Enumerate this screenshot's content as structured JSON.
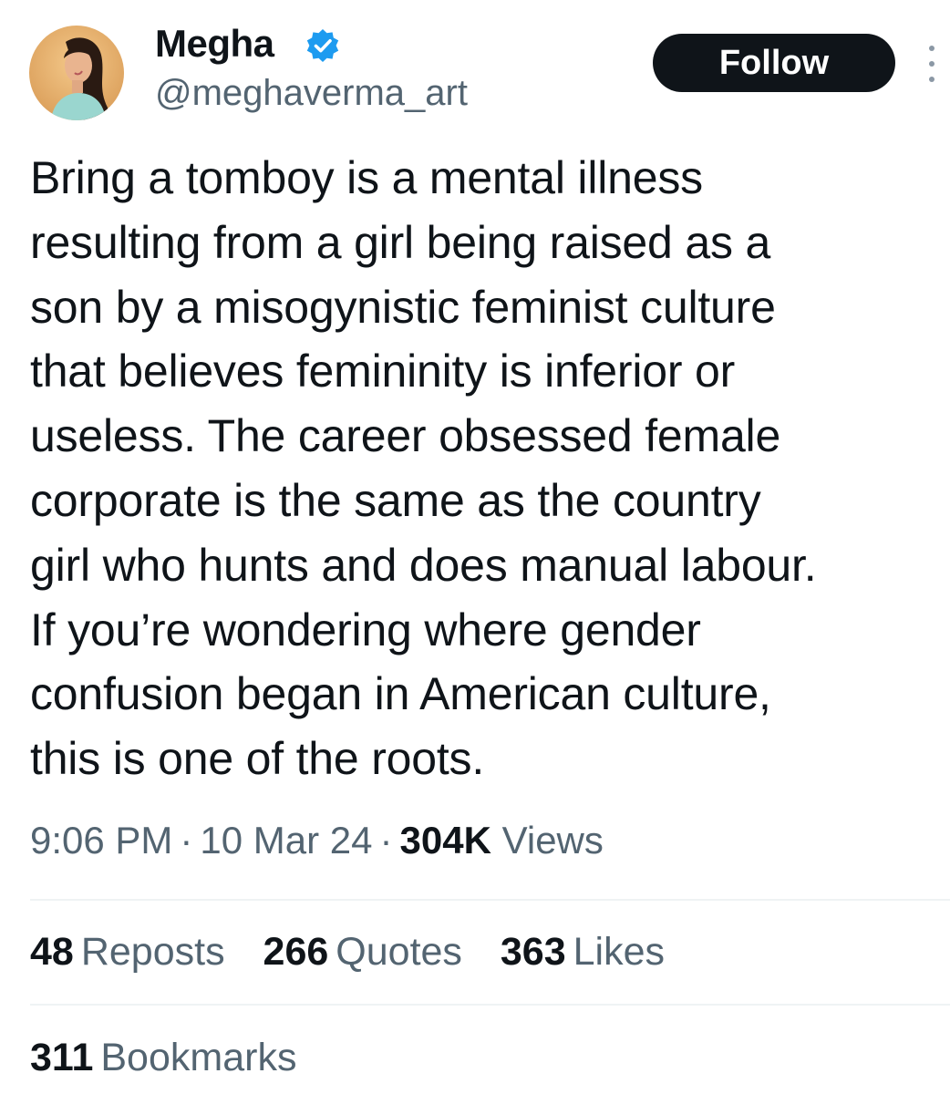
{
  "author": {
    "display_name": "Megha",
    "handle": "@meghaverma_art",
    "verified": true,
    "avatar_icon": "profile-photo"
  },
  "actions": {
    "follow_label": "Follow",
    "more_icon": "more-vertical-icon"
  },
  "tweet": {
    "text": "Bring a tomboy is a mental illness\nresulting from a girl being raised as a\nson by a misogynistic feminist culture\nthat believes femininity is inferior or\nuseless. The career obsessed female\ncorporate is the same as the country\ngirl who hunts and does manual labour.\nIf you’re wondering where gender\nconfusion began in American culture,\nthis is one of the roots.",
    "time": "9:06 PM",
    "separator": "·",
    "date": "10 Mar 24",
    "views_count": "304K",
    "views_label": "Views"
  },
  "stats": {
    "reposts_count": "48",
    "reposts_label": "Reposts",
    "quotes_count": "266",
    "quotes_label": "Quotes",
    "likes_count": "363",
    "likes_label": "Likes",
    "bookmarks_count": "311",
    "bookmarks_label": "Bookmarks"
  },
  "colors": {
    "text_primary": "#0f1419",
    "text_secondary": "#536471",
    "verified_blue": "#1d9bf0",
    "follow_button_bg": "#0f1419",
    "divider": "#eff3f4"
  }
}
